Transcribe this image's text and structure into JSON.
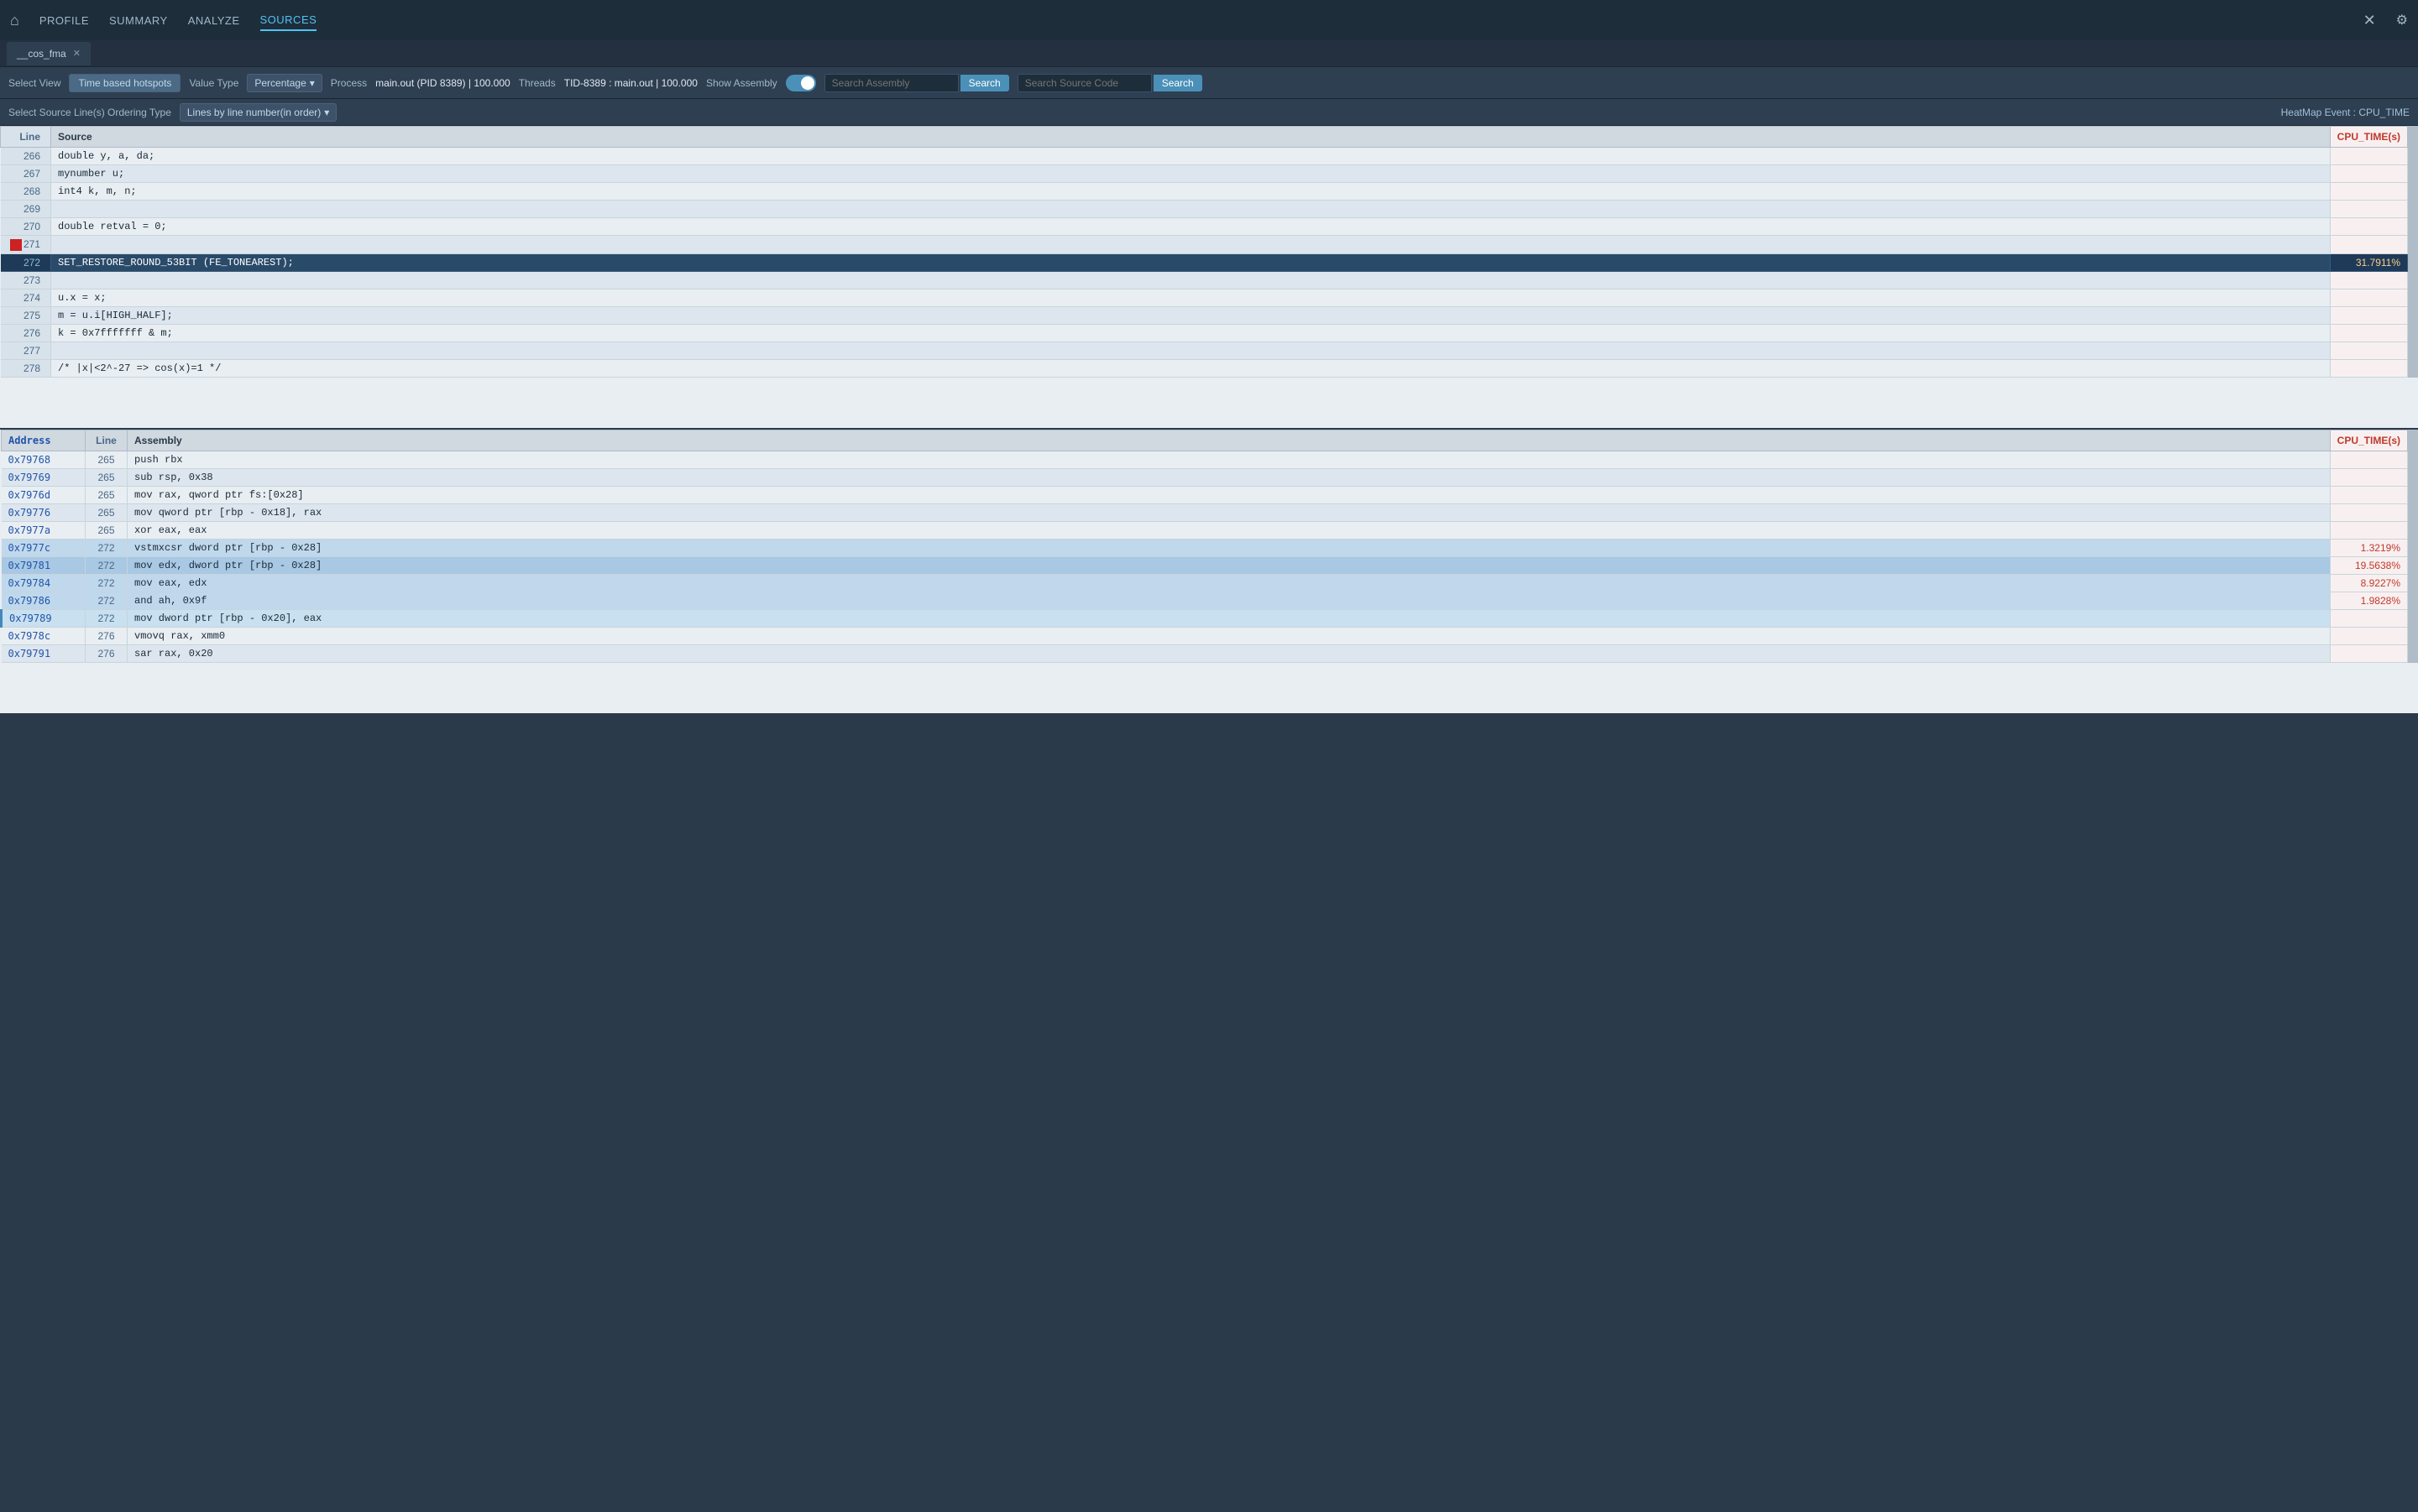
{
  "nav": {
    "home_icon": "⌂",
    "items": [
      {
        "label": "PROFILE",
        "active": false
      },
      {
        "label": "SUMMARY",
        "active": false
      },
      {
        "label": "ANALYZE",
        "active": false
      },
      {
        "label": "SOURCES",
        "active": true
      }
    ],
    "close_icon": "✕",
    "settings_icon": "⚙"
  },
  "tab": {
    "label": "__cos_fma",
    "close": "✕"
  },
  "toolbar1": {
    "select_view_label": "Select View",
    "view_value": "Time based hotspots",
    "value_type_label": "Value Type",
    "value_type": "Percentage",
    "process_label": "Process",
    "process_value": "main.out (PID 8389) | 100.000",
    "threads_label": "Threads",
    "threads_value": "TID-8389 : main.out | 100.000",
    "show_assembly_label": "Show Assembly",
    "search_assembly_placeholder": "Search Assembly",
    "search_assembly_btn": "Search",
    "search_source_placeholder": "Search Source Code",
    "search_source_btn": "Search"
  },
  "toolbar2": {
    "select_ordering_label": "Select Source Line(s) Ordering Type",
    "ordering_value": "Lines by line number(in order)",
    "heatmap_label": "HeatMap Event : CPU_TIME"
  },
  "source_table": {
    "headers": [
      "Line",
      "Source",
      "CPU_TIME(s)"
    ],
    "rows": [
      {
        "line": "266",
        "source": "double y, a, da;",
        "cpu": "",
        "style": ""
      },
      {
        "line": "267",
        "source": "mynumber u;",
        "cpu": "",
        "style": ""
      },
      {
        "line": "268",
        "source": "int4 k, m, n;",
        "cpu": "",
        "style": ""
      },
      {
        "line": "269",
        "source": "",
        "cpu": "",
        "style": ""
      },
      {
        "line": "270",
        "source": "double retval = 0;",
        "cpu": "",
        "style": ""
      },
      {
        "line": "271",
        "source": "",
        "cpu": "",
        "style": "red"
      },
      {
        "line": "272",
        "source": "SET_RESTORE_ROUND_53BIT (FE_TONEAREST);",
        "cpu": "31.7911%",
        "style": "highlight"
      },
      {
        "line": "273",
        "source": "",
        "cpu": "",
        "style": ""
      },
      {
        "line": "274",
        "source": "u.x = x;",
        "cpu": "",
        "style": ""
      },
      {
        "line": "275",
        "source": "m = u.i[HIGH_HALF];",
        "cpu": "",
        "style": ""
      },
      {
        "line": "276",
        "source": "k = 0x7fffffff & m;",
        "cpu": "",
        "style": ""
      },
      {
        "line": "277",
        "source": "",
        "cpu": "",
        "style": ""
      },
      {
        "line": "278",
        "source": "/* |x|<2^-27 => cos(x)=1 */",
        "cpu": "",
        "style": ""
      }
    ]
  },
  "assembly_table": {
    "headers": [
      "Address",
      "Line",
      "Assembly",
      "CPU_TIME(s)"
    ],
    "rows": [
      {
        "addr": "0x79768",
        "line": "265",
        "asm": "push rbx",
        "cpu": "",
        "style": ""
      },
      {
        "addr": "0x79769",
        "line": "265",
        "asm": "sub rsp, 0x38",
        "cpu": "",
        "style": ""
      },
      {
        "addr": "0x7976d",
        "line": "265",
        "asm": "mov rax, qword ptr fs:[0x28]",
        "cpu": "",
        "style": ""
      },
      {
        "addr": "0x79776",
        "line": "265",
        "asm": "mov qword ptr [rbp - 0x18], rax",
        "cpu": "",
        "style": ""
      },
      {
        "addr": "0x7977a",
        "line": "265",
        "asm": "xor eax, eax",
        "cpu": "",
        "style": ""
      },
      {
        "addr": "0x7977c",
        "line": "272",
        "asm": "vstmxcsr dword ptr [rbp - 0x28]",
        "cpu": "1.3219%",
        "style": "hot1"
      },
      {
        "addr": "0x79781",
        "line": "272",
        "asm": "mov edx, dword ptr [rbp - 0x28]",
        "cpu": "19.5638%",
        "style": "hot2"
      },
      {
        "addr": "0x79784",
        "line": "272",
        "asm": "mov eax, edx",
        "cpu": "8.9227%",
        "style": "hot1"
      },
      {
        "addr": "0x79786",
        "line": "272",
        "asm": "and ah, 0x9f",
        "cpu": "1.9828%",
        "style": "hot1"
      },
      {
        "addr": "0x79789",
        "line": "272",
        "asm": "mov dword ptr [rbp - 0x20], eax",
        "cpu": "",
        "style": "selected"
      },
      {
        "addr": "0x7978c",
        "line": "276",
        "asm": "vmovq rax, xmm0",
        "cpu": "",
        "style": ""
      },
      {
        "addr": "0x79791",
        "line": "276",
        "asm": "sar rax, 0x20",
        "cpu": "",
        "style": ""
      }
    ]
  }
}
